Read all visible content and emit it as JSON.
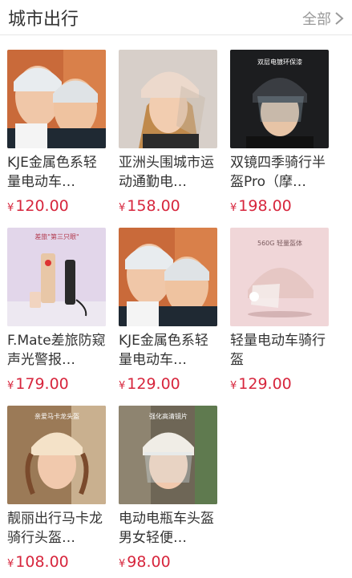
{
  "header": {
    "title": "城市出行",
    "more_label": "全部"
  },
  "currency_symbol": "¥",
  "products": [
    {
      "title": "KJE金属色系轻量电动车…",
      "price": "120.00",
      "image": "helmet-couple-photo"
    },
    {
      "title": "亚洲头围城市运动通勤电…",
      "price": "158.00",
      "image": "helmet-woman-visor-photo"
    },
    {
      "title": "双镜四季骑行半盔Pro（摩…",
      "price": "198.00",
      "image": "helmet-man-dual-visor-photo",
      "image_text": "双层电镀环保漆"
    },
    {
      "title": "F.Mate差旅防窥声光警报…",
      "price": "179.00",
      "image": "travel-alarm-device-photo",
      "image_text": "差旅\"第三只眼\""
    },
    {
      "title": "KJE金属色系轻量电动车…",
      "price": "129.00",
      "image": "helmet-couple-photo"
    },
    {
      "title": "轻量电动车骑行盔",
      "price": "129.00",
      "image": "helmet-pink-product-photo",
      "image_text": "560G 轻量盔体"
    },
    {
      "title": "靓丽出行马卡龙骑行头盔…",
      "price": "108.00",
      "image": "helmet-woman-macaron-photo",
      "image_text": "亲爱马卡龙头盔"
    },
    {
      "title": "电动电瓶车头盔男女轻便…",
      "price": "98.00",
      "image": "helmet-woman-clear-visor-photo",
      "image_text": "强化高清镜片"
    }
  ]
}
